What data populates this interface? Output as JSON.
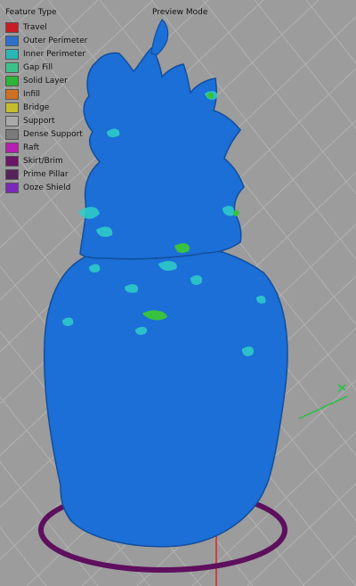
{
  "legend": {
    "title": "Feature Type",
    "items": [
      {
        "label": "Travel",
        "color": "#c81d25"
      },
      {
        "label": "Outer Perimeter",
        "color": "#2f6fc9"
      },
      {
        "label": "Inner Perimeter",
        "color": "#2ab6b6"
      },
      {
        "label": "Gap Fill",
        "color": "#3ec28a"
      },
      {
        "label": "Solid Layer",
        "color": "#2fb43a"
      },
      {
        "label": "Infill",
        "color": "#cf6f22"
      },
      {
        "label": "Bridge",
        "color": "#c4be2c"
      },
      {
        "label": "Support",
        "color": "#a9a9a9"
      },
      {
        "label": "Dense Support",
        "color": "#7a7a7a"
      },
      {
        "label": "Raft",
        "color": "#b61fb0"
      },
      {
        "label": "Skirt/Brim",
        "color": "#6b1666"
      },
      {
        "label": "Prime Pillar",
        "color": "#55235a"
      },
      {
        "label": "Ooze Shield",
        "color": "#7a2ab8"
      }
    ]
  },
  "mode_label": "Preview Mode",
  "scene": {
    "model_color": "#1b6fd6",
    "model_highlight_color": "#2fd0c8",
    "solid_layer_color": "#39c23f",
    "skirt_color": "#5e0f5e",
    "grid_color": "#b2b2b2",
    "axis_x_color": "#e02020",
    "axis_y_color": "#22c040"
  }
}
